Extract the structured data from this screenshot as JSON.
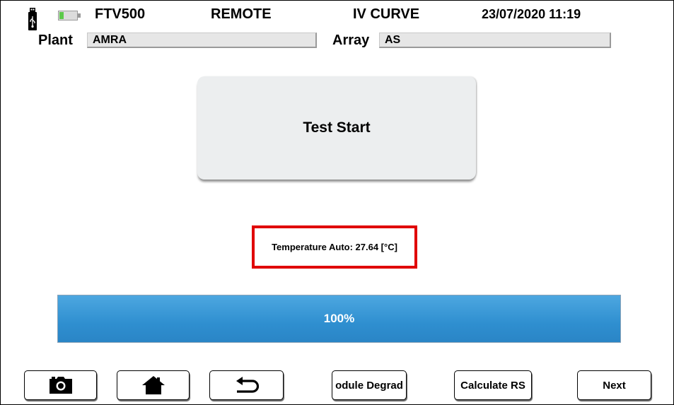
{
  "header": {
    "device": "FTV500",
    "mode": "REMOTE",
    "function": "IV CURVE",
    "datetime": "23/07/2020 11:19",
    "icons": [
      "usb-icon",
      "battery-icon"
    ]
  },
  "plant": {
    "label": "Plant",
    "value": "AMRA"
  },
  "array": {
    "label": "Array",
    "value": "AS"
  },
  "main": {
    "start_label": "Test Start",
    "temperature": "Temperature Auto: 27.64 [°C]"
  },
  "progress": {
    "label": "100%",
    "value": 1.0,
    "color": "#3193d4"
  },
  "toolbar": {
    "camera_icon": "camera-icon",
    "home_icon": "home-icon",
    "back_icon": "return-arrow-icon",
    "module_degrad_label": "odule Degrad",
    "calculate_rs_label": "Calculate RS",
    "next_label": "Next"
  },
  "colors": {
    "highlight": "#e00000",
    "progress": "#3193d4"
  }
}
